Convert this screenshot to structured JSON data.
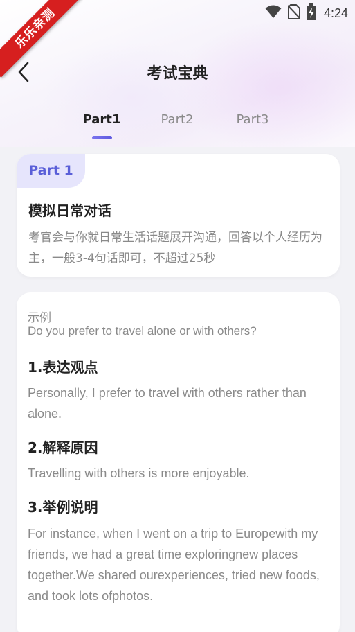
{
  "status_bar": {
    "time": "4:24",
    "icons": [
      "wifi-icon",
      "no-sim-icon",
      "battery-charging-icon"
    ]
  },
  "ribbon": {
    "text": "乐乐亲测"
  },
  "nav": {
    "title": "考试宝典",
    "back_icon": "chevron-left-icon"
  },
  "tabs": [
    {
      "label": "Part1",
      "active": true
    },
    {
      "label": "Part2",
      "active": false
    },
    {
      "label": "Part3",
      "active": false
    }
  ],
  "intro_card": {
    "badge": "Part 1",
    "title": "模拟日常对话",
    "description": "考官会与你就日常生活话题展开沟通，回答以个人经历为主，一般3-4句话即可，不超过25秒"
  },
  "example_card": {
    "label": "示例",
    "question": "Do you prefer to travel alone or with others?",
    "sections": [
      {
        "title": "1.表达观点",
        "text": "Personally, I prefer to travel with others rather than alone."
      },
      {
        "title": "2.解释原因",
        "text": "Travelling with others is more enjoyable."
      },
      {
        "title": "3.举例说明",
        "text": "For instance, when I went on a trip to Europewith my friends, we had a great time exploringnew places together.We shared ourexperiences, tried new foods, and took lots ofphotos."
      }
    ]
  },
  "colors": {
    "accent": "#5f5ae0",
    "badge_bg": "#e6e5fc",
    "ribbon": "#d61f1f",
    "page_bg": "#f2f2f6"
  }
}
